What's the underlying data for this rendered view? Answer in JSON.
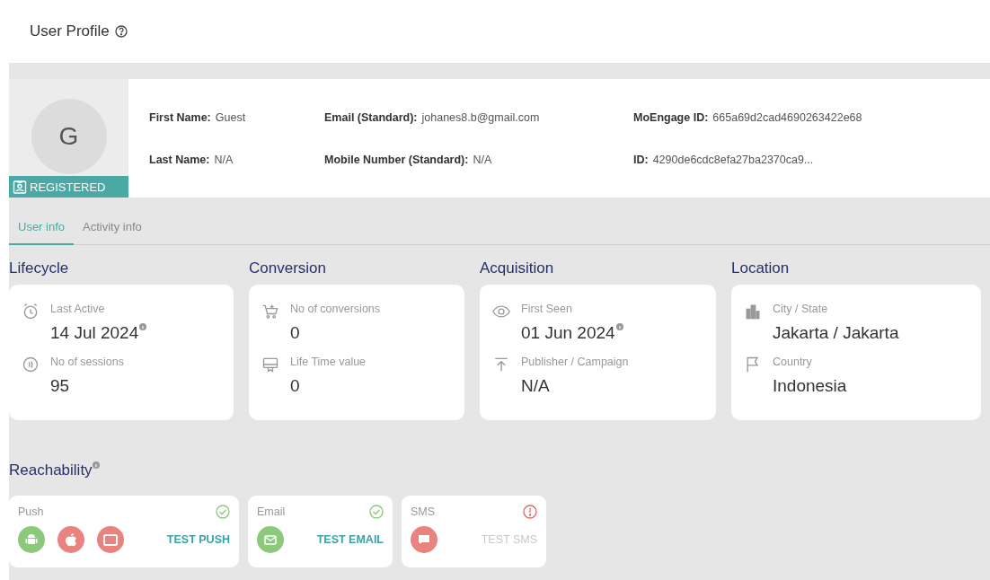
{
  "page_title": "User Profile",
  "profile": {
    "avatar_letter": "G",
    "badge": "REGISTERED",
    "fields": [
      {
        "label": "First Name:",
        "value": "Guest"
      },
      {
        "label": "Email (Standard):",
        "value": "johanes8.b@gmail.com"
      },
      {
        "label": "MoEngage ID:",
        "value": "665a69d2cad4690263422e68"
      },
      {
        "label": "Last Name:",
        "value": "N/A"
      },
      {
        "label": "Mobile Number (Standard):",
        "value": "N/A"
      },
      {
        "label": "ID:",
        "value": "4290de6cdc8efa27ba2370ca9..."
      }
    ]
  },
  "tabs": [
    {
      "label": "User info",
      "selected": true
    },
    {
      "label": "Activity info",
      "selected": false
    }
  ],
  "sections": [
    {
      "title": "Lifecycle",
      "items": [
        {
          "kind": "alarm",
          "label": "Last Active",
          "value": "14 Jul 2024",
          "info": true
        },
        {
          "kind": "sessions",
          "label": "No of sessions",
          "value": "95",
          "info": false
        }
      ]
    },
    {
      "title": "Conversion",
      "items": [
        {
          "kind": "cart",
          "label": "No of conversions",
          "value": "0",
          "info": false
        },
        {
          "kind": "monitor",
          "label": "Life Time value",
          "value": "0",
          "info": false
        }
      ]
    },
    {
      "title": "Acquisition",
      "items": [
        {
          "kind": "eye",
          "label": "First Seen",
          "value": "01 Jun 2024",
          "info": true
        },
        {
          "kind": "upload",
          "label": "Publisher / Campaign",
          "value": "N/A",
          "info": false
        }
      ]
    },
    {
      "title": "Location",
      "items": [
        {
          "kind": "building",
          "label": "City / State",
          "value": "Jakarta / Jakarta",
          "info": false
        },
        {
          "kind": "flag",
          "label": "Country",
          "value": "Indonesia",
          "info": false
        }
      ]
    }
  ],
  "reachability": {
    "title": "Reachability",
    "info": true,
    "channels": [
      {
        "name": "Push",
        "reachable": true,
        "icons": [
          {
            "kind": "android",
            "color": "#8cc97a"
          },
          {
            "kind": "apple",
            "color": "#e8837f"
          },
          {
            "kind": "web",
            "color": "#e8837f"
          }
        ],
        "test_button": {
          "label": "TEST PUSH",
          "disabled": false
        }
      },
      {
        "name": "Email",
        "reachable": true,
        "icons": [
          {
            "kind": "mail",
            "color": "#8cc97a"
          }
        ],
        "test_button": {
          "label": "TEST EMAIL",
          "disabled": false
        }
      },
      {
        "name": "SMS",
        "reachable": false,
        "icons": [
          {
            "kind": "chat",
            "color": "#e8837f"
          }
        ],
        "test_button": {
          "label": "TEST SMS",
          "disabled": true
        }
      }
    ]
  }
}
